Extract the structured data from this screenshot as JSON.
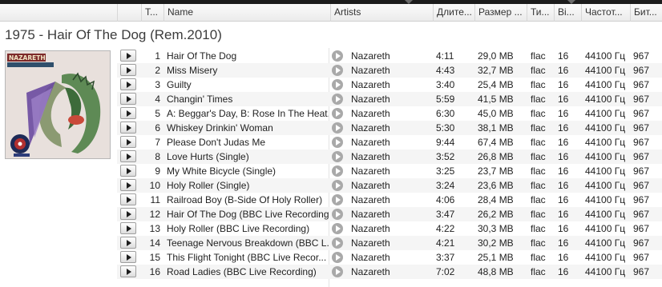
{
  "columns": {
    "num": "Т...",
    "name": "Name",
    "artists": "Artists",
    "duration": "Длите...",
    "size": "Размер ...",
    "type": "Ти...",
    "bits": "Bi...",
    "freq": "Частот...",
    "bitrate": "Бит..."
  },
  "album": {
    "title": "1975 - Hair Of The Dog (Rem.2010)",
    "cover_text": "NAZARETH"
  },
  "tracks": [
    {
      "num": "1",
      "name": "Hair Of The Dog",
      "artist": "Nazareth",
      "duration": "4:11",
      "size": "29,0 MB",
      "type": "flac",
      "bits": "16",
      "freq": "44100 Гц",
      "bitrate": "967"
    },
    {
      "num": "2",
      "name": "Miss Misery",
      "artist": "Nazareth",
      "duration": "4:43",
      "size": "32,7 MB",
      "type": "flac",
      "bits": "16",
      "freq": "44100 Гц",
      "bitrate": "967"
    },
    {
      "num": "3",
      "name": "Guilty",
      "artist": "Nazareth",
      "duration": "3:40",
      "size": "25,4 MB",
      "type": "flac",
      "bits": "16",
      "freq": "44100 Гц",
      "bitrate": "967"
    },
    {
      "num": "4",
      "name": "Changin' Times",
      "artist": "Nazareth",
      "duration": "5:59",
      "size": "41,5 MB",
      "type": "flac",
      "bits": "16",
      "freq": "44100 Гц",
      "bitrate": "967"
    },
    {
      "num": "5",
      "name": "A: Beggar's Day, B: Rose In The Heat...",
      "artist": "Nazareth",
      "duration": "6:30",
      "size": "45,0 MB",
      "type": "flac",
      "bits": "16",
      "freq": "44100 Гц",
      "bitrate": "967"
    },
    {
      "num": "6",
      "name": "Whiskey Drinkin' Woman",
      "artist": "Nazareth",
      "duration": "5:30",
      "size": "38,1 MB",
      "type": "flac",
      "bits": "16",
      "freq": "44100 Гц",
      "bitrate": "967"
    },
    {
      "num": "7",
      "name": "Please Don't Judas Me",
      "artist": "Nazareth",
      "duration": "9:44",
      "size": "67,4 MB",
      "type": "flac",
      "bits": "16",
      "freq": "44100 Гц",
      "bitrate": "967"
    },
    {
      "num": "8",
      "name": "Love Hurts (Single)",
      "artist": "Nazareth",
      "duration": "3:52",
      "size": "26,8 MB",
      "type": "flac",
      "bits": "16",
      "freq": "44100 Гц",
      "bitrate": "967"
    },
    {
      "num": "9",
      "name": "My White Bicycle (Single)",
      "artist": "Nazareth",
      "duration": "3:25",
      "size": "23,7 MB",
      "type": "flac",
      "bits": "16",
      "freq": "44100 Гц",
      "bitrate": "967"
    },
    {
      "num": "10",
      "name": "Holy Roller (Single)",
      "artist": "Nazareth",
      "duration": "3:24",
      "size": "23,6 MB",
      "type": "flac",
      "bits": "16",
      "freq": "44100 Гц",
      "bitrate": "967"
    },
    {
      "num": "11",
      "name": "Railroad Boy (B-Side Of Holy Roller)",
      "artist": "Nazareth",
      "duration": "4:06",
      "size": "28,4 MB",
      "type": "flac",
      "bits": "16",
      "freq": "44100 Гц",
      "bitrate": "967"
    },
    {
      "num": "12",
      "name": "Hair Of The Dog (BBC Live Recording)",
      "artist": "Nazareth",
      "duration": "3:47",
      "size": "26,2 MB",
      "type": "flac",
      "bits": "16",
      "freq": "44100 Гц",
      "bitrate": "967"
    },
    {
      "num": "13",
      "name": "Holy Roller (BBC Live Recording)",
      "artist": "Nazareth",
      "duration": "4:22",
      "size": "30,3 MB",
      "type": "flac",
      "bits": "16",
      "freq": "44100 Гц",
      "bitrate": "967"
    },
    {
      "num": "14",
      "name": "Teenage Nervous Breakdown (BBC L...",
      "artist": "Nazareth",
      "duration": "4:21",
      "size": "30,2 MB",
      "type": "flac",
      "bits": "16",
      "freq": "44100 Гц",
      "bitrate": "967"
    },
    {
      "num": "15",
      "name": "This Flight Tonight (BBC Live Recor...",
      "artist": "Nazareth",
      "duration": "3:37",
      "size": "25,1 MB",
      "type": "flac",
      "bits": "16",
      "freq": "44100 Гц",
      "bitrate": "967"
    },
    {
      "num": "16",
      "name": "Road Ladies (BBC Live Recording)",
      "artist": "Nazareth",
      "duration": "7:02",
      "size": "48,8 MB",
      "type": "flac",
      "bits": "16",
      "freq": "44100 Гц",
      "bitrate": "967"
    }
  ]
}
